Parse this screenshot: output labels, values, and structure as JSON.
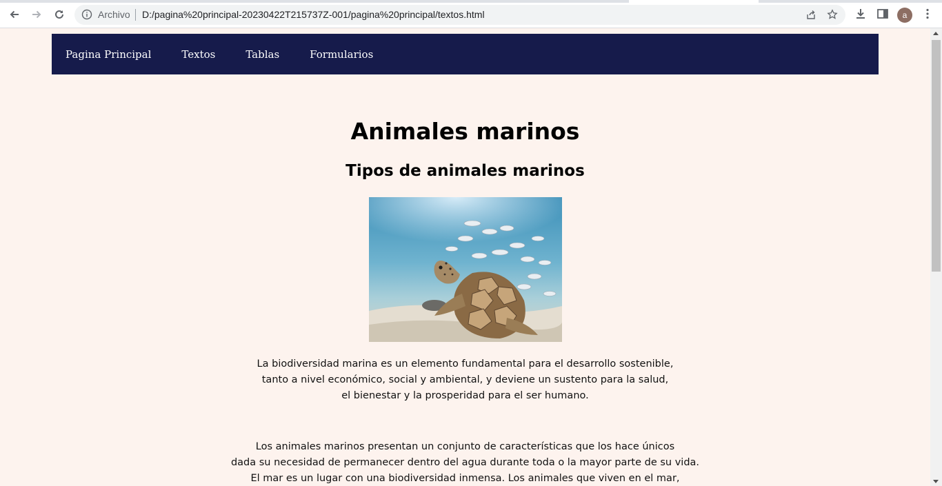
{
  "browser": {
    "security_chip": "Archivo",
    "url": "D:/pagina%20principal-20230422T215737Z-001/pagina%20principal/textos.html",
    "avatar_letter": "a",
    "icons": [
      "back-arrow-icon",
      "forward-arrow-icon",
      "reload-icon",
      "info-icon",
      "share-icon",
      "star-icon",
      "download-icon",
      "side-panel-icon",
      "kebab-menu-icon"
    ]
  },
  "nav": {
    "items": [
      "Pagina Principal",
      "Textos",
      "Tablas",
      "Formularios"
    ]
  },
  "content": {
    "title": "Animales marinos",
    "subtitle": "Tipos de animales marinos",
    "paragraph1": [
      "La biodiversidad marina es un elemento fundamental para el desarrollo sostenible,",
      "tanto a nivel económico, social y ambiental, y deviene un sustento para la salud,",
      "el bienestar y la prosperidad para el ser humano."
    ],
    "paragraph2": [
      "Los animales marinos presentan un conjunto de características que los hace únicos",
      "dada su necesidad de permanecer dentro del agua durante toda o la mayor parte de su vida.",
      "El mar es un lugar con una biodiversidad inmensa. Los animales que viven en el mar,"
    ]
  },
  "colors": {
    "nav_background": "#161b4b",
    "page_background": "#fdf3ee"
  }
}
